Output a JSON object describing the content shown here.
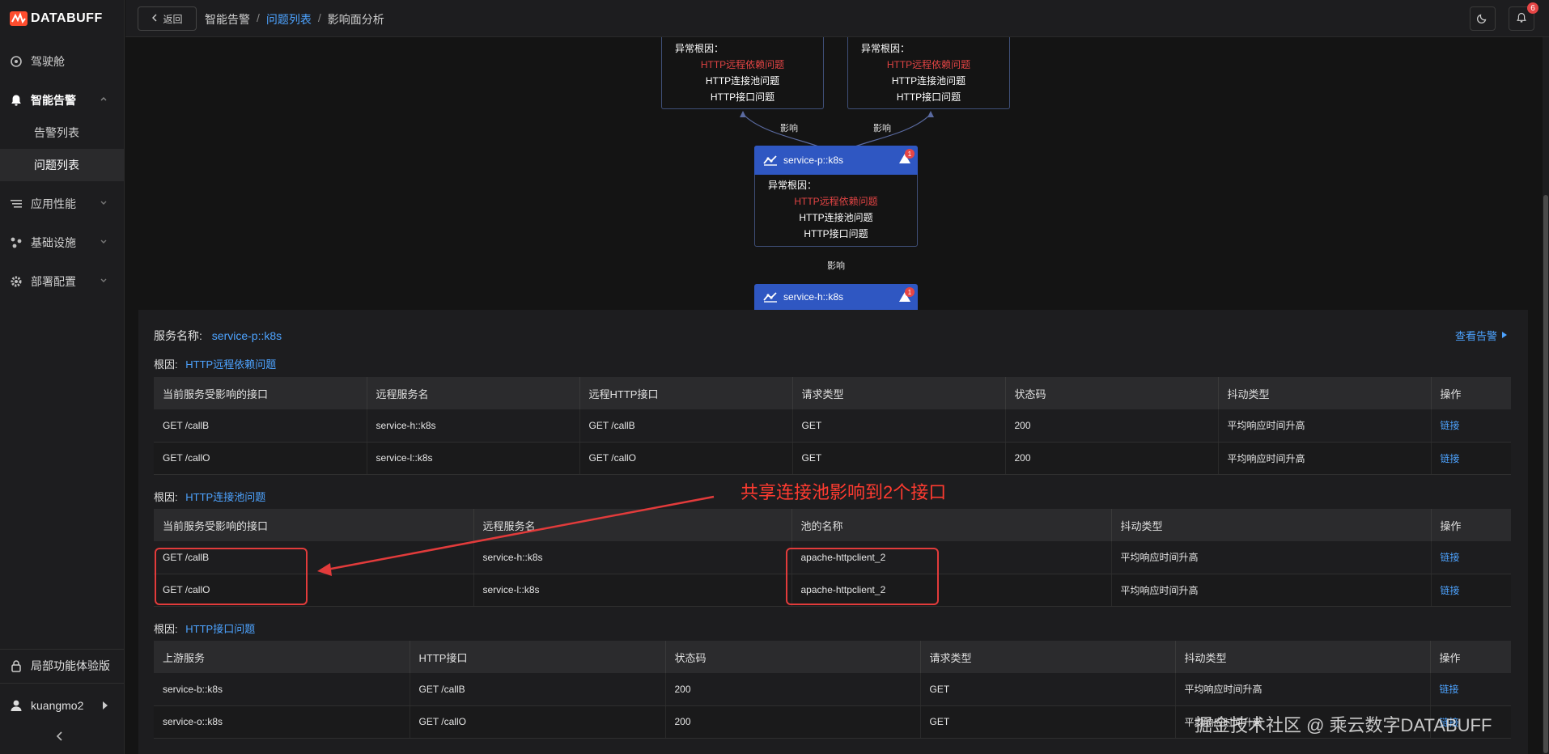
{
  "app": {
    "logo_text": "DATABUFF"
  },
  "sidebar": {
    "items": [
      {
        "label": "驾驶舱",
        "icon": "cockpit-icon"
      },
      {
        "label": "智能告警",
        "icon": "bell-icon"
      },
      {
        "label": "应用性能",
        "icon": "list-icon"
      },
      {
        "label": "基础设施",
        "icon": "nodes-icon"
      },
      {
        "label": "部署配置",
        "icon": "gear-icon"
      }
    ],
    "sub_items": [
      {
        "label": "告警列表"
      },
      {
        "label": "问题列表"
      }
    ],
    "bottom": {
      "trial_label": "局部功能体验版",
      "user_label": "kuangmo2"
    }
  },
  "header": {
    "back_label": "返回",
    "breadcrumb": [
      "智能告警",
      "问题列表",
      "影响面分析"
    ],
    "notification_count": "6"
  },
  "graph": {
    "root_cause_title": "异常根因：",
    "causes": [
      "HTTP远程依赖问题",
      "HTTP连接池问题",
      "HTTP接口问题"
    ],
    "edge_label": "影响",
    "node_p": {
      "name": "service-p::k8s",
      "alert_count": "1"
    },
    "node_h": {
      "name": "service-h::k8s",
      "alert_count": "1"
    }
  },
  "detail": {
    "service_label": "服务名称:",
    "service_value": "service-p::k8s",
    "view_alert_label": "查看告警",
    "root_label": "根因:",
    "sections": [
      {
        "root": "HTTP远程依赖问题",
        "headers": [
          "当前服务受影响的接口",
          "远程服务名",
          "远程HTTP接口",
          "请求类型",
          "状态码",
          "抖动类型",
          "操作"
        ],
        "rows": [
          [
            "GET /callB",
            "service-h::k8s",
            "GET /callB",
            "GET",
            "200",
            "平均响应时间升高",
            "链接"
          ],
          [
            "GET /callO",
            "service-l::k8s",
            "GET /callO",
            "GET",
            "200",
            "平均响应时间升高",
            "链接"
          ]
        ]
      },
      {
        "root": "HTTP连接池问题",
        "headers": [
          "当前服务受影响的接口",
          "远程服务名",
          "池的名称",
          "抖动类型",
          "操作"
        ],
        "rows": [
          [
            "GET /callB",
            "service-h::k8s",
            "apache-httpclient_2",
            "平均响应时间升高",
            "链接"
          ],
          [
            "GET /callO",
            "service-l::k8s",
            "apache-httpclient_2",
            "平均响应时间升高",
            "链接"
          ]
        ]
      },
      {
        "root": "HTTP接口问题",
        "headers": [
          "上游服务",
          "HTTP接口",
          "状态码",
          "请求类型",
          "抖动类型",
          "操作"
        ],
        "rows": [
          [
            "service-b::k8s",
            "GET /callB",
            "200",
            "GET",
            "平均响应时间升高",
            "链接"
          ],
          [
            "service-o::k8s",
            "GET /callO",
            "200",
            "GET",
            "平均响应时间升高",
            "链接"
          ]
        ]
      }
    ]
  },
  "annotation": {
    "text": "共享连接池影响到2个接口"
  },
  "watermark": "掘金技术社区 @ 乘云数字DATABUFF",
  "colors": {
    "accent": "#4da3ff",
    "node": "#2f57c2",
    "error": "#e24444",
    "annotation": "#e23b3b"
  }
}
